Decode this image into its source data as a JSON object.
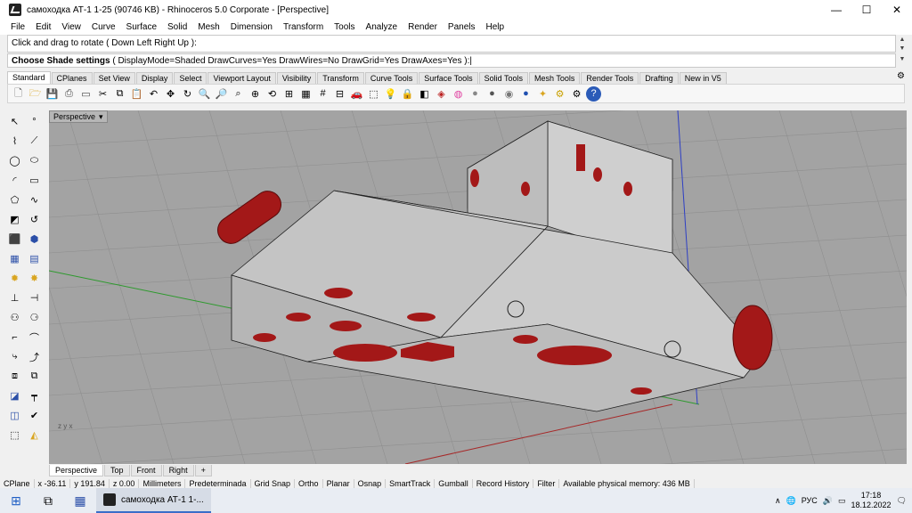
{
  "window": {
    "title": "самоходка АТ-1 1-25 (90746 KB) - Rhinoceros  5.0 Corporate - [Perspective]",
    "minimize": "—",
    "maximize": "☐",
    "close": "✕"
  },
  "menu": [
    "File",
    "Edit",
    "View",
    "Curve",
    "Surface",
    "Solid",
    "Mesh",
    "Dimension",
    "Transform",
    "Tools",
    "Analyze",
    "Render",
    "Panels",
    "Help"
  ],
  "command": {
    "history": "Click and drag to rotate ( Down  Left  Right  Up ):",
    "prompt_bold": "Choose Shade settings",
    "prompt_rest": " ( DisplayMode=Shaded  DrawCurves=Yes  DrawWires=No  DrawGrid=Yes  DrawAxes=Yes ):"
  },
  "tool_tabs": [
    "Standard",
    "CPlanes",
    "Set View",
    "Display",
    "Select",
    "Viewport Layout",
    "Visibility",
    "Transform",
    "Curve Tools",
    "Surface Tools",
    "Solid Tools",
    "Mesh Tools",
    "Render Tools",
    "Drafting",
    "New in V5"
  ],
  "viewport": {
    "title": "Perspective",
    "tabs": [
      "Perspective",
      "Top",
      "Front",
      "Right"
    ],
    "add_tab": "+",
    "axis_y": "y",
    "axis_z": "z",
    "axis_x": "x"
  },
  "status": {
    "cplane": "CPlane",
    "x": "x -36.11",
    "y": "y 191.84",
    "z": "z 0.00",
    "units": "Millimeters",
    "layer": "Predeterminada",
    "grid_snap": "Grid Snap",
    "ortho": "Ortho",
    "planar": "Planar",
    "osnap": "Osnap",
    "smarttrack": "SmartTrack",
    "gumball": "Gumball",
    "record_history": "Record History",
    "filter": "Filter",
    "memory": "Available physical memory: 436 MB"
  },
  "taskbar": {
    "app_label": "самоходка АТ-1 1-...",
    "lang": "РУС",
    "time": "17:18",
    "date": "18.12.2022"
  },
  "colors": {
    "viewport_bg": "#a3a3a3",
    "grid": "#8c8c8c",
    "body": "#c9c9c9",
    "accent_red": "#a31818",
    "x_axis": "#a62828",
    "y_axis": "#2e9a2e",
    "z_axis": "#2e3fc4"
  }
}
